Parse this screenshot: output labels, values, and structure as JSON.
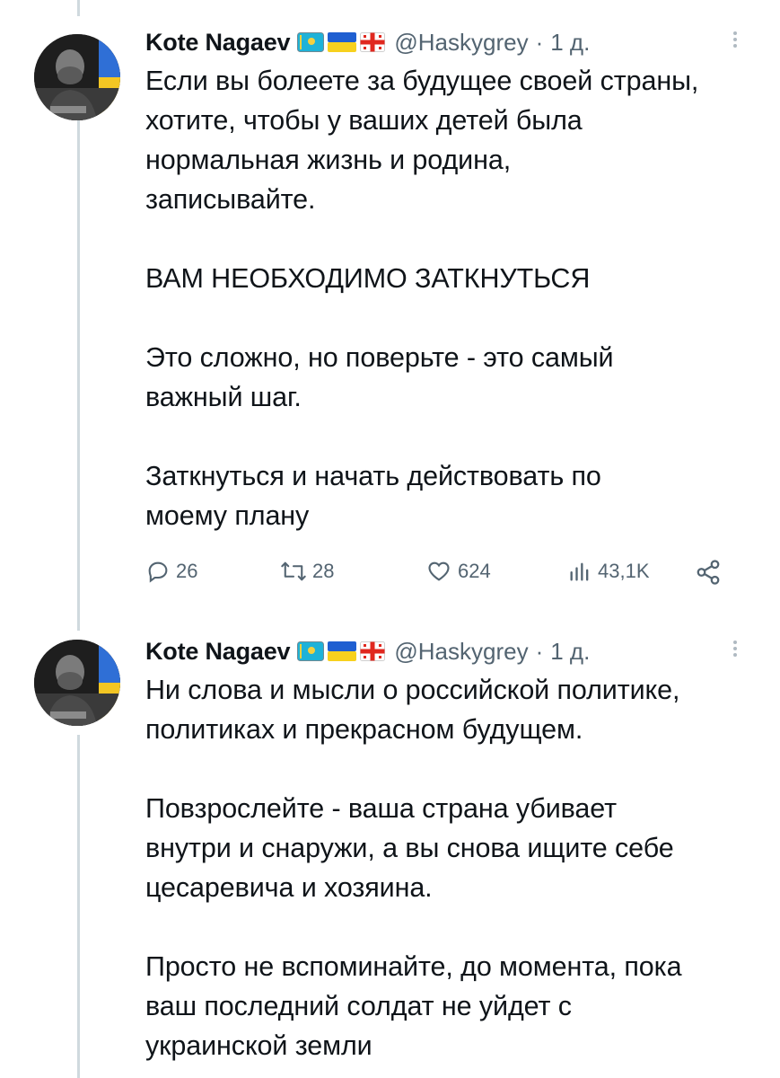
{
  "colors": {
    "text": "#0f1419",
    "secondary": "#536471",
    "thread_line": "#cfd9de"
  },
  "tweets": [
    {
      "author": {
        "name": "Kote Nagaev",
        "flags": [
          "kazakhstan-flag",
          "ukraine-flag",
          "georgia-flag"
        ],
        "handle": "@Haskygrey",
        "separator": "·",
        "time": "1 д."
      },
      "lines": [
        "Если вы болеете за будущее своей страны,",
        "хотите, чтобы у ваших детей была",
        "нормальная жизнь и родина,",
        "записывайте.",
        "",
        "ВАМ НЕОБХОДИМО ЗАТКНУТЬСЯ",
        "",
        "Это сложно, но поверьте - это самый",
        "важный шаг.",
        "",
        "Заткнуться и начать действовать по",
        "моему плану"
      ],
      "stats": {
        "replies": "26",
        "retweets": "28",
        "likes": "624",
        "views": "43,1K"
      }
    },
    {
      "author": {
        "name": "Kote Nagaev",
        "flags": [
          "kazakhstan-flag",
          "ukraine-flag",
          "georgia-flag"
        ],
        "handle": "@Haskygrey",
        "separator": "·",
        "time": "1 д."
      },
      "lines": [
        "Ни слова и мысли о российской политике,",
        "политиках и прекрасном будущем.",
        "",
        "Повзрослейте - ваша страна убивает",
        "внутри и снаружи, а вы снова ищите себе",
        "цесаревича и хозяина.",
        "",
        "Просто не вспоминайте, до момента, пока",
        "ваш последний солдат не уйдет с",
        "украинской земли"
      ]
    }
  ]
}
